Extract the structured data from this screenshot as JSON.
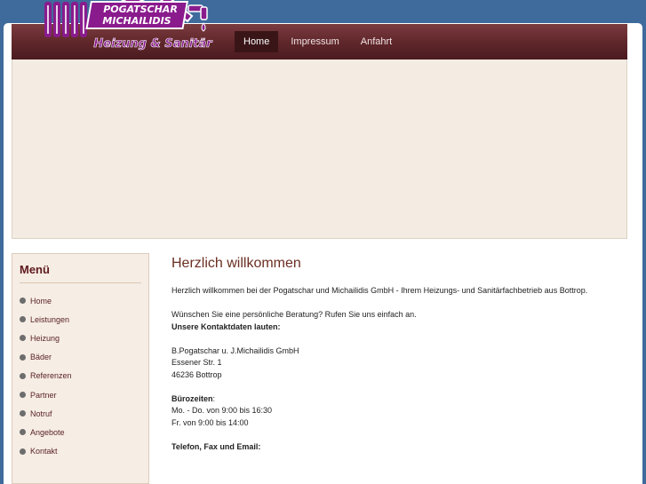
{
  "logo": {
    "line1": "POGATSCHAR",
    "line2": "MICHAILIDIS",
    "tagline": "Heizung & Sanitär"
  },
  "nav": {
    "items": [
      {
        "label": "Home",
        "active": true
      },
      {
        "label": "Impressum",
        "active": false
      },
      {
        "label": "Anfahrt",
        "active": false
      }
    ]
  },
  "sidebar": {
    "title": "Menü",
    "items": [
      {
        "label": "Home"
      },
      {
        "label": "Leistungen"
      },
      {
        "label": "Heizung"
      },
      {
        "label": "Bäder"
      },
      {
        "label": "Referenzen"
      },
      {
        "label": "Partner"
      },
      {
        "label": "Notruf"
      },
      {
        "label": "Angebote"
      },
      {
        "label": "Kontakt"
      }
    ]
  },
  "content": {
    "title": "Herzlich willkommen",
    "intro": "Herzlich willkommen bei der Pogatschar und Michailidis GmbH - Ihrem Heizungs- und Sanitärfachbetrieb aus Bottrop.",
    "consult": "Wünschen Sie eine persönliche Beratung? Rufen Sie uns einfach an.",
    "contact_heading": "Unsere Kontaktdaten lauten:",
    "company": "B.Pogatschar u. J.Michailidis GmbH",
    "street": "Essener Str. 1",
    "city": "46236 Bottrop",
    "hours_heading": "Bürozeiten",
    "hours_suffix": ":",
    "hours_weekdays": "Mo. - Do. von 9:00 bis 16:30",
    "hours_friday": "Fr. von 9:00 bis 14:00",
    "phone_heading": "Telefon, Fax und Email:"
  },
  "colors": {
    "header": "#5e262a",
    "accent": "#6a2e22",
    "logo_purple": "#8a1b8d",
    "background": "#3f6a9c"
  }
}
